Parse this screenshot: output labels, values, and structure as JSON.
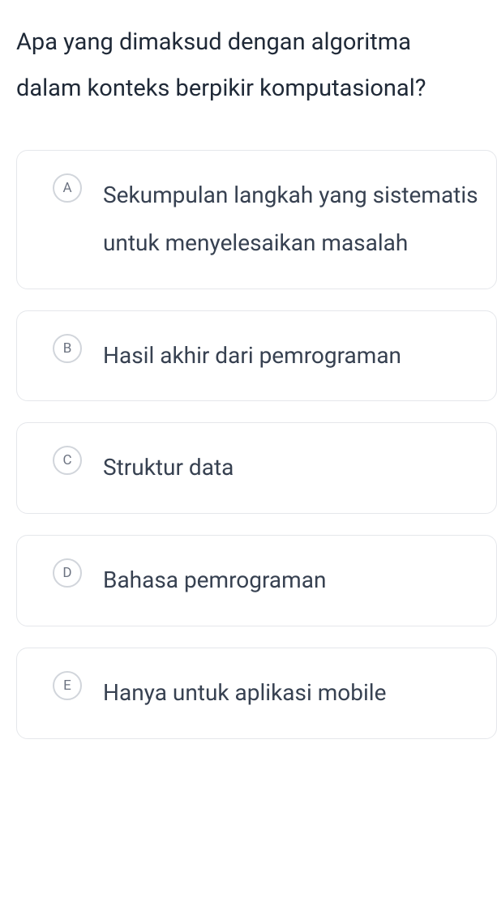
{
  "question": "Apa yang dimaksud dengan algoritma dalam konteks berpikir komputasional?",
  "options": [
    {
      "letter": "A",
      "text": "Sekumpulan langkah yang sistematis untuk menyelesaikan masalah"
    },
    {
      "letter": "B",
      "text": "Hasil akhir dari pemrograman"
    },
    {
      "letter": "C",
      "text": "Struktur data"
    },
    {
      "letter": "D",
      "text": "Bahasa pemrograman"
    },
    {
      "letter": "E",
      "text": "Hanya untuk aplikasi mobile"
    }
  ]
}
